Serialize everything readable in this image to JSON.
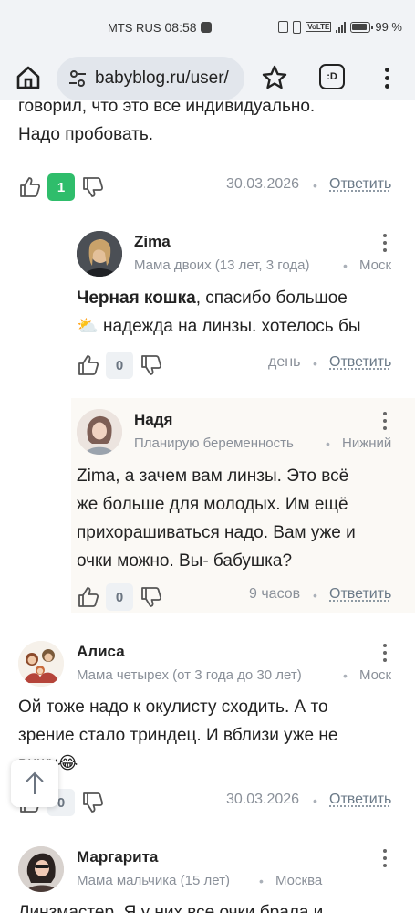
{
  "status_bar": {
    "carrier": "MTS RUS",
    "time": "08:58",
    "battery": "99 %"
  },
  "browser": {
    "url": "babyblog.ru/user/",
    "tabs_label": ":D"
  },
  "comments": [
    {
      "text_lines": [
        "говорил, что это все индивидуально.",
        "Надо пробовать."
      ],
      "likes": "1",
      "date": "30.03.2026",
      "reply": "Ответить"
    },
    {
      "author": "Zima",
      "subtitle": "Мама двоих (13 лет, 3 года)",
      "location": "Моск",
      "mention": "Черная кошка",
      "text": ", спасибо большое",
      "text2": " надежда на линзы. хотелось бы",
      "emoji": "⛅",
      "likes": "0",
      "date": "день",
      "reply": "Ответить"
    },
    {
      "author": "Надя",
      "subtitle": "Планирую беременность",
      "location": "Нижний",
      "mention": "Zima",
      "text_lines": [
        ", а зачем вам линзы. Это всё",
        "же больше для молодых. Им ещё",
        "прихорашиваться надо. Вам уже и",
        "очки можно. Вы- бабушка?"
      ],
      "likes": "0",
      "date": "9 часов",
      "reply": "Ответить"
    },
    {
      "author": "Алиса",
      "subtitle": "Мама четырех (от 3 года до 30 лет)",
      "location": "Моск",
      "text_lines": [
        "Ой тоже надо к окулисту сходить. А то",
        "зрение стало триндец. И вблизи уже не",
        "вижу😂"
      ],
      "likes": "0",
      "date": "30.03.2026",
      "reply": "Ответить"
    },
    {
      "author": "Маргарита",
      "subtitle": "Мама мальчика (15 лет)",
      "location": "Москва",
      "text_lines": [
        "Линзмастер. Я у них все очки брала и"
      ]
    }
  ],
  "colors": {
    "accent_green": "#2fbd6b",
    "muted_text": "#8a9099"
  },
  "icons": {
    "like": "thumb-up-icon",
    "dislike": "thumb-down-icon",
    "scroll_top": "arrow-up-icon"
  }
}
